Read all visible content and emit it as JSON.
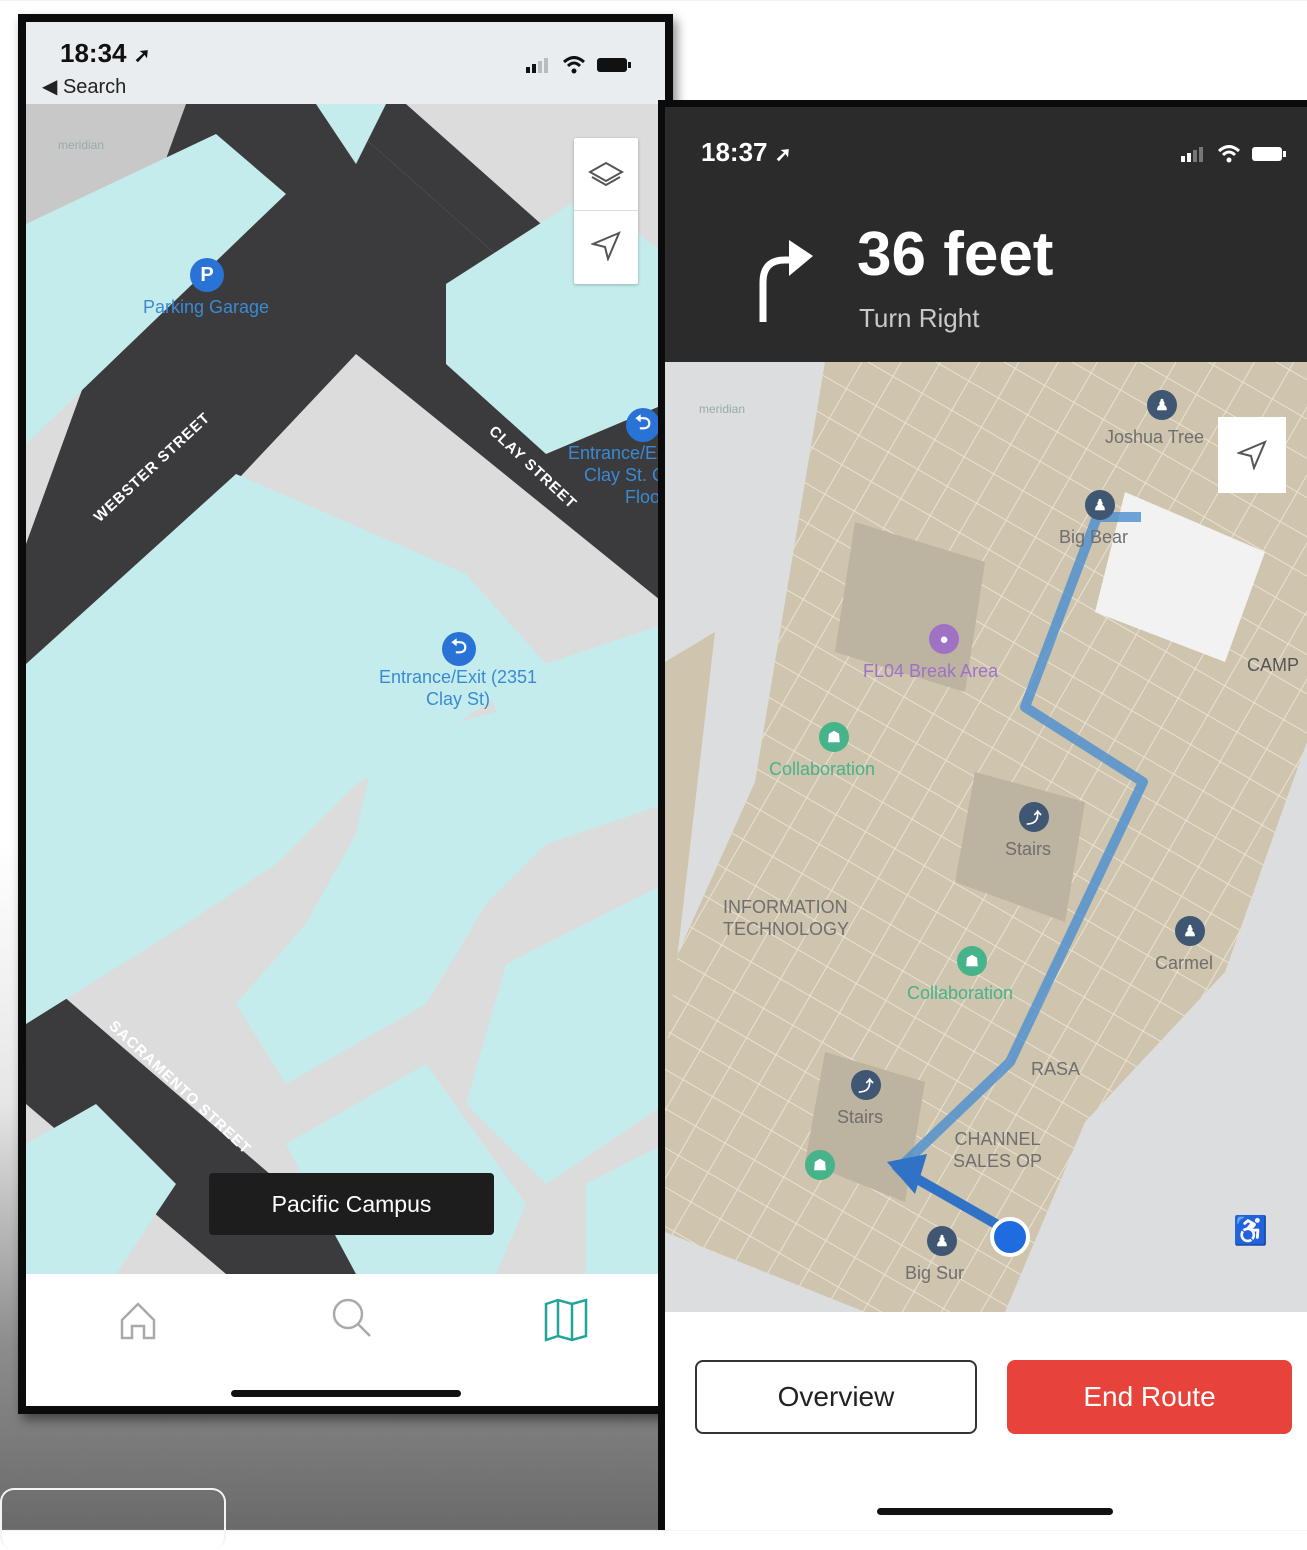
{
  "phone1": {
    "status": {
      "time": "18:34",
      "back_label": "◀ Search"
    },
    "map": {
      "watermark": "meridian",
      "streets": [
        "WEBSTER STREET",
        "CLAY STREET",
        "SACRAMENTO STREET"
      ],
      "pois": [
        {
          "icon": "P",
          "label": "Parking Garage"
        },
        {
          "icon": "⮌",
          "label_line1": "Entrance/Exit (2351",
          "label_line2": "Clay St)"
        },
        {
          "icon": "⮌",
          "label_line1": "Entrance/Ex",
          "label_line2": "Clay St. G",
          "label_line3": "Floor"
        }
      ],
      "campus_badge": "Pacific Campus"
    },
    "tabs": [
      "home-icon",
      "search-icon",
      "map-icon"
    ],
    "colors": {
      "accent": "#21a59a",
      "poi": "#3a8ad3",
      "building": "#c4ecec",
      "street": "#3b3b3d"
    }
  },
  "phone2": {
    "status": {
      "time": "18:37"
    },
    "nav": {
      "distance": "36 feet",
      "instruction": "Turn Right"
    },
    "map": {
      "watermark": "meridian",
      "rooms": {
        "joshua_tree": "Joshua Tree",
        "big_bear": "Big Bear",
        "break_area": "FL04 Break Area",
        "collab1": "Collaboration",
        "stairs1": "Stairs",
        "it_line1": "INFORMATION",
        "it_line2": "TECHNOLOGY",
        "collab2": "Collaboration",
        "carmel": "Carmel",
        "rasa": "RASA",
        "stairs2": "Stairs",
        "channel_line1": "CHANNEL",
        "channel_line2": "SALES OP",
        "big_sur": "Big Sur",
        "camp": "CAMP"
      }
    },
    "buttons": {
      "overview": "Overview",
      "end_route": "End Route"
    },
    "colors": {
      "end_route": "#e8433a",
      "route": "#3b82c4",
      "header": "#2b2b2b"
    }
  }
}
